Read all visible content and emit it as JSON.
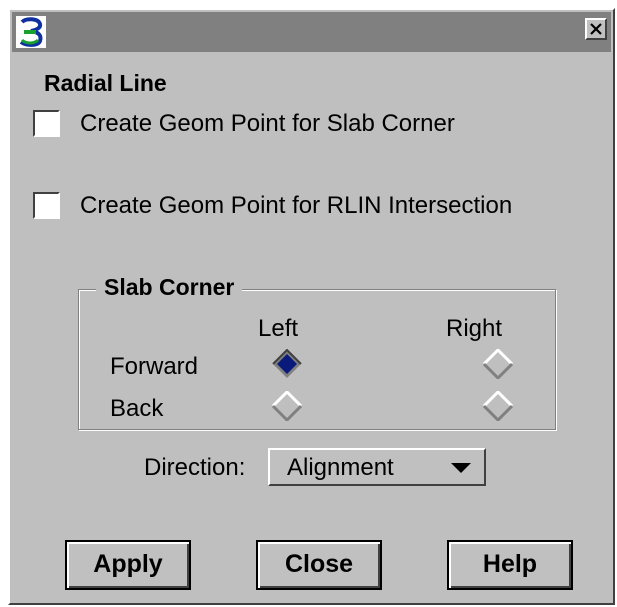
{
  "window": {
    "close_symbol": "×",
    "icon": "app-logo-icon"
  },
  "radial_line": {
    "title": "Radial Line",
    "checkboxes": [
      {
        "label": "Create Geom Point for Slab Corner",
        "checked": false
      },
      {
        "label": "Create Geom Point for RLIN Intersection",
        "checked": false
      }
    ]
  },
  "slab_corner": {
    "title": "Slab Corner",
    "col_left": "Left",
    "col_right": "Right",
    "row_forward": "Forward",
    "row_back": "Back",
    "selected": "forward-left"
  },
  "direction": {
    "label": "Direction:",
    "value": "Alignment"
  },
  "buttons": {
    "apply": "Apply",
    "close": "Close",
    "help": "Help"
  },
  "colors": {
    "selected_radio": "#0a1a7a",
    "dialog_bg": "#bfbfbf",
    "titlebar": "#808080"
  }
}
